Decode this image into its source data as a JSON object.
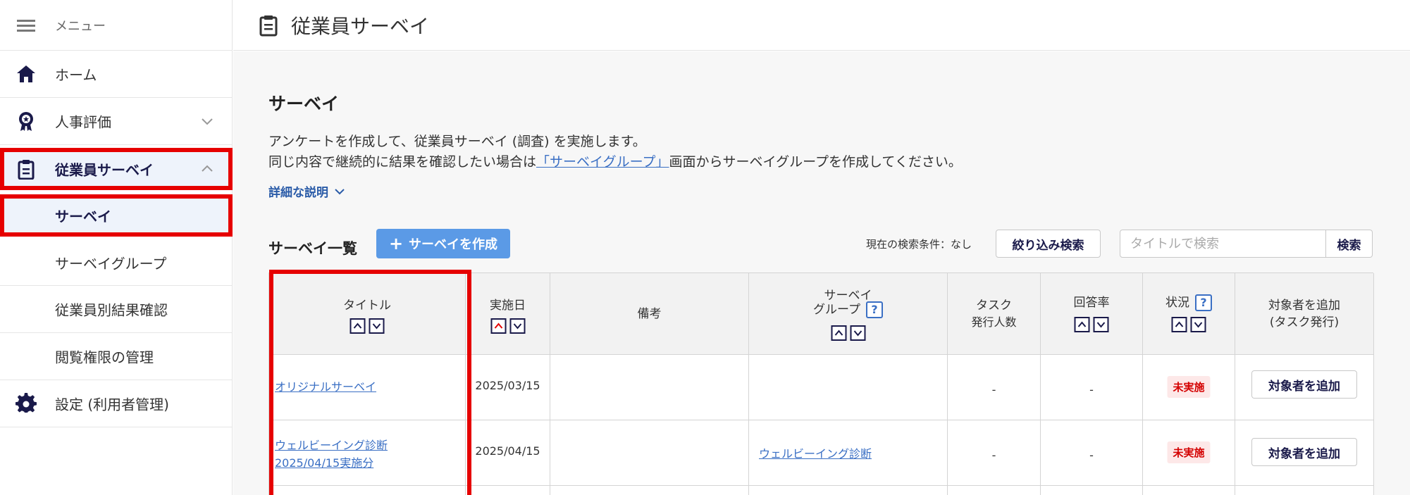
{
  "sidebar": {
    "menu_label": "メニュー",
    "items": [
      {
        "label": "ホーム",
        "icon": "home-icon"
      },
      {
        "label": "人事評価",
        "icon": "award-icon"
      },
      {
        "label": "従業員サーベイ",
        "icon": "clipboard-icon"
      },
      {
        "label": "サーベイ"
      },
      {
        "label": "サーベイグループ"
      },
      {
        "label": "従業員別結果確認"
      },
      {
        "label": "閲覧権限の管理"
      },
      {
        "label": "設定 (利用者管理)",
        "icon": "gear-icon"
      }
    ]
  },
  "header": {
    "title": "従業員サーベイ",
    "icon": "clipboard-icon"
  },
  "main": {
    "section_title": "サーベイ",
    "desc_line1": "アンケートを作成して、従業員サーベイ (調査) を実施します。",
    "desc_line2_pre": "同じ内容で継続的に結果を確認したい場合は",
    "desc_line2_link": "「サーベイグループ」",
    "desc_line2_post": "画面からサーベイグループを作成してください。",
    "detail_link": "詳細な説明",
    "list_title": "サーベイ一覧",
    "create_button": "サーベイを作成",
    "search_condition": "現在の検索条件：なし",
    "filter_button": "絞り込み検索",
    "search_placeholder": "タイトルで検索",
    "search_button": "検索"
  },
  "table": {
    "headers": {
      "title": "タイトル",
      "date": "実施日",
      "note": "備考",
      "group_line1": "サーベイ",
      "group_line2": "グループ",
      "task_line1": "タスク",
      "task_line2": "発行人数",
      "rate": "回答率",
      "status": "状況",
      "add_line1": "対象者を追加",
      "add_line2": "(タスク発行)"
    },
    "rows": [
      {
        "title": "オリジナルサーベイ",
        "title_line2": "",
        "date": "2025/03/15",
        "note": "",
        "group": "",
        "task": "-",
        "rate": "-",
        "status": "未実施",
        "add_button": "対象者を追加"
      },
      {
        "title": "ウェルビーイング診断",
        "title_line2": "2025/04/15実施分",
        "date": "2025/04/15",
        "note": "",
        "group": "ウェルビーイング診断",
        "task": "-",
        "rate": "-",
        "status": "未実施",
        "add_button": "対象者を追加"
      }
    ]
  },
  "colors": {
    "accent": "#5b9ae6",
    "link": "#3a6fc4",
    "highlight": "#e60000",
    "navy": "#1a1a4a",
    "status_bg": "#fde8e8",
    "status_text": "#d40000"
  }
}
